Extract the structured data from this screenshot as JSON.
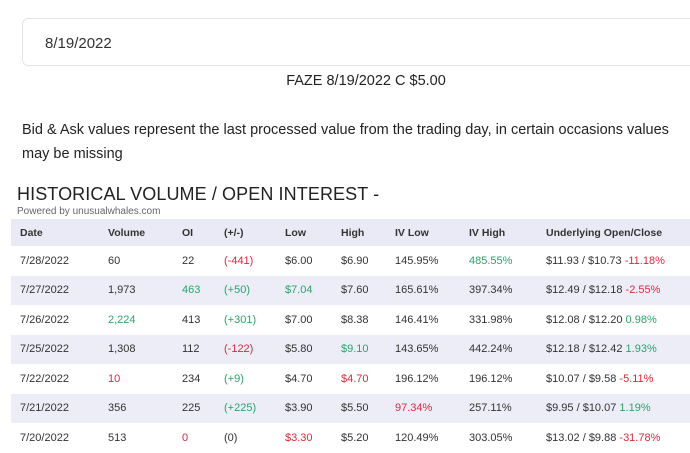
{
  "date_select": {
    "value": "8/19/2022"
  },
  "contract": {
    "title": "FAZE 8/19/2022 C $5.00"
  },
  "note": {
    "line1": "Bid & Ask values represent the last processed value from the trading day, in certain occasions values",
    "line2": "may be missing"
  },
  "history": {
    "title": "HISTORICAL VOLUME / OPEN INTEREST -",
    "powered_by": "Powered by unusualwhales.com",
    "columns": [
      "Date",
      "Volume",
      "OI",
      "(+/-)",
      "Low",
      "High",
      "IV Low",
      "IV High",
      "Underlying Open/Close"
    ],
    "rows": [
      {
        "date": "7/28/2022",
        "volume": "60",
        "oi": "22",
        "change": "(-441)",
        "low": "$6.00",
        "high": "$6.90",
        "iv_low": "145.95%",
        "iv_high": "485.55%",
        "underlying": "$11.93 / $10.73",
        "underlying_change": "-11.18%"
      },
      {
        "date": "7/27/2022",
        "volume": "1,973",
        "oi": "463",
        "change": "(+50)",
        "low": "$7.04",
        "high": "$7.60",
        "iv_low": "165.61%",
        "iv_high": "397.34%",
        "underlying": "$12.49 / $12.18",
        "underlying_change": "-2.55%"
      },
      {
        "date": "7/26/2022",
        "volume": "2,224",
        "oi": "413",
        "change": "(+301)",
        "low": "$7.00",
        "high": "$8.38",
        "iv_low": "146.41%",
        "iv_high": "331.98%",
        "underlying": "$12.08 / $12.20",
        "underlying_change": "0.98%"
      },
      {
        "date": "7/25/2022",
        "volume": "1,308",
        "oi": "112",
        "change": "(-122)",
        "low": "$5.80",
        "high": "$9.10",
        "iv_low": "143.65%",
        "iv_high": "442.24%",
        "underlying": "$12.18 / $12.42",
        "underlying_change": "1.93%"
      },
      {
        "date": "7/22/2022",
        "volume": "10",
        "oi": "234",
        "change": "(+9)",
        "low": "$4.70",
        "high": "$4.70",
        "iv_low": "196.12%",
        "iv_high": "196.12%",
        "underlying": "$10.07 / $9.58",
        "underlying_change": "-5.11%"
      },
      {
        "date": "7/21/2022",
        "volume": "356",
        "oi": "225",
        "change": "(+225)",
        "low": "$3.90",
        "high": "$5.50",
        "iv_low": "97.34%",
        "iv_high": "257.11%",
        "underlying": "$9.95 / $10.07",
        "underlying_change": "1.19%"
      },
      {
        "date": "7/20/2022",
        "volume": "513",
        "oi": "0",
        "change": "(0)",
        "low": "$3.30",
        "high": "$5.20",
        "iv_low": "120.49%",
        "iv_high": "303.05%",
        "underlying": "$13.02 / $9.88",
        "underlying_change": "-31.78%"
      }
    ]
  },
  "colors": {
    "positive": "#27a56a",
    "negative": "#d62b3a",
    "row_shade": "#ededf8",
    "header_bg": "#eaeaf6"
  }
}
